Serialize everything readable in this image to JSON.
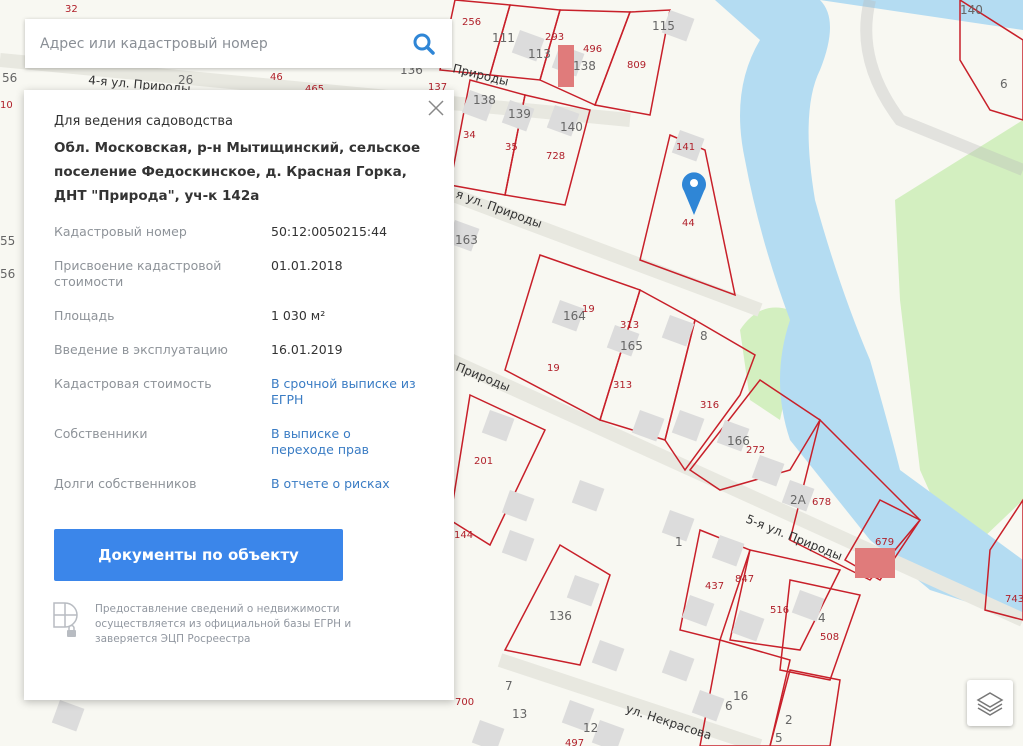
{
  "search": {
    "placeholder": "Адрес или кадастровый номер",
    "value": "",
    "icon": "search-icon",
    "icon_color": "#2f86d6"
  },
  "card": {
    "purpose": "Для ведения садоводства",
    "address": "Обл. Московская, р-н Мытищинский, сельское поселение Федоскинское, д. Красная Горка, ДНТ \"Природа\", уч-к 142а",
    "rows": [
      {
        "label": "Кадастровый номер",
        "value": "50:12:0050215:44",
        "link": false
      },
      {
        "label": "Присвоение кадастровой стоимости",
        "value": "01.01.2018",
        "link": false
      },
      {
        "label": "Площадь",
        "value": "1 030 м²",
        "link": false
      },
      {
        "label": "Введение в эксплуатацию",
        "value": "16.01.2019",
        "link": false
      },
      {
        "label": "Кадастровая стоимость",
        "value": "В срочной выписке из ЕГРН",
        "link": true
      },
      {
        "label": "Собственники",
        "value": "В выписке о переходе прав",
        "link": true
      },
      {
        "label": "Долги собственников",
        "value": "В отчете о рисках",
        "link": true
      }
    ],
    "button": "Документы по объекту",
    "button_color": "#3b86ea",
    "note": "Предоставление сведений о недвижимости осуществляется из официальной базы ЕГРН и заверяется ЭЦП Росреестра"
  },
  "map": {
    "streets": [
      "4-я ул. Природы",
      "Природы",
      "я ул. Природы",
      "Природы",
      "5-я ул. Природы",
      "ул. Некрасова"
    ],
    "parcel_labels": [
      "32",
      "256",
      "111",
      "113",
      "293",
      "496",
      "138",
      "115",
      "809",
      "140",
      "6",
      "56",
      "26",
      "46",
      "465",
      "136",
      "137",
      "10",
      "138",
      "139",
      "140",
      "34",
      "35",
      "728",
      "141",
      "44",
      "55",
      "163",
      "56",
      "164",
      "19",
      "313",
      "165",
      "8",
      "19",
      "313",
      "316",
      "201",
      "166",
      "272",
      "2А",
      "678",
      "679",
      "144",
      "1",
      "437",
      "847",
      "516",
      "136",
      "4",
      "508",
      "743",
      "7",
      "13",
      "12",
      "497",
      "6",
      "16",
      "2",
      "5",
      "700"
    ],
    "colors": {
      "parcel_border": "#c8202a",
      "water": "#b4dcf2",
      "green": "#d3efc0",
      "building": "#dcdcdc",
      "highlight": "#e07b7b",
      "marker": "#2f86d6"
    }
  },
  "controls": {
    "layers_icon": "layers-icon"
  }
}
